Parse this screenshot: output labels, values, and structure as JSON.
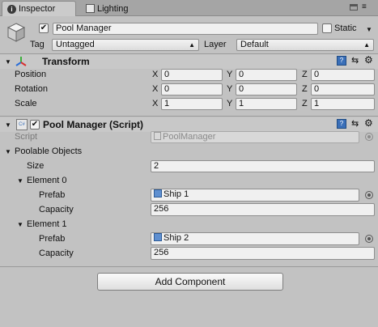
{
  "tabs": [
    {
      "label": "Inspector",
      "icon": "info-icon",
      "active": true
    },
    {
      "label": "Lighting",
      "icon": "lighting-icon",
      "active": false
    }
  ],
  "gameobject": {
    "active_checked": true,
    "name": "Pool Manager",
    "static_label": "Static",
    "static_checked": false,
    "tag_label": "Tag",
    "tag_value": "Untagged",
    "layer_label": "Layer",
    "layer_value": "Default"
  },
  "transform": {
    "title": "Transform",
    "rows": [
      {
        "label": "Position",
        "x": "0",
        "y": "0",
        "z": "0"
      },
      {
        "label": "Rotation",
        "x": "0",
        "y": "0",
        "z": "0"
      },
      {
        "label": "Scale",
        "x": "1",
        "y": "1",
        "z": "1"
      }
    ],
    "axis_labels": [
      "X",
      "Y",
      "Z"
    ]
  },
  "script_component": {
    "enabled": true,
    "title": "Pool Manager (Script)",
    "script_label": "Script",
    "script_value": "PoolManager",
    "poolable_label": "Poolable Objects",
    "size_label": "Size",
    "size_value": "2",
    "elements": [
      {
        "label": "Element 0",
        "prefab_label": "Prefab",
        "prefab_value": "Ship 1",
        "capacity_label": "Capacity",
        "capacity_value": "256"
      },
      {
        "label": "Element 1",
        "prefab_label": "Prefab",
        "prefab_value": "Ship 2",
        "capacity_label": "Capacity",
        "capacity_value": "256"
      }
    ]
  },
  "add_component_label": "Add Component",
  "colors": {
    "panel": "#c2c2c2",
    "tabbar": "#a5a5a5",
    "field": "#f0f0f0"
  }
}
